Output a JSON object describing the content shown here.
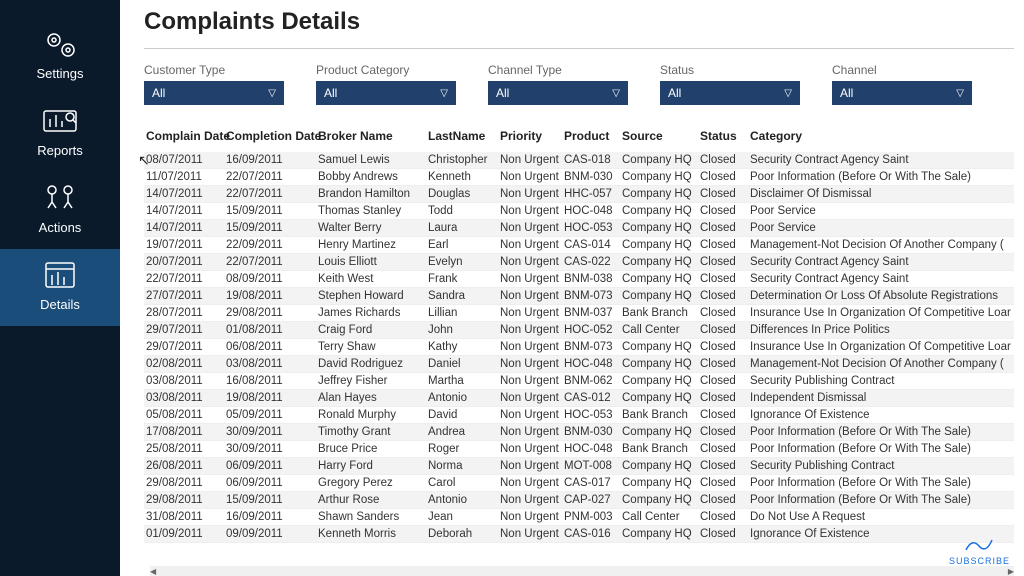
{
  "sidebar": {
    "items": [
      {
        "label": "Settings"
      },
      {
        "label": "Reports"
      },
      {
        "label": "Actions"
      },
      {
        "label": "Details"
      }
    ]
  },
  "page": {
    "title": "Complaints Details"
  },
  "filters": [
    {
      "label": "Customer Type",
      "value": "All"
    },
    {
      "label": "Product Category",
      "value": "All"
    },
    {
      "label": "Channel Type",
      "value": "All"
    },
    {
      "label": "Status",
      "value": "All"
    },
    {
      "label": "Channel",
      "value": "All"
    }
  ],
  "table": {
    "headers": [
      "Complain Date",
      "Completion Date",
      "Broker Name",
      "LastName",
      "Priority",
      "Product",
      "Source",
      "Status",
      "Category"
    ],
    "rows": [
      [
        "08/07/2011",
        "16/09/2011",
        "Samuel Lewis",
        "Christopher",
        "Non Urgent",
        "CAS-018",
        "Company HQ",
        "Closed",
        "Security Contract Agency Saint"
      ],
      [
        "11/07/2011",
        "22/07/2011",
        "Bobby Andrews",
        "Kenneth",
        "Non Urgent",
        "BNM-030",
        "Company HQ",
        "Closed",
        "Poor Information (Before Or With The Sale)"
      ],
      [
        "14/07/2011",
        "22/07/2011",
        "Brandon Hamilton",
        "Douglas",
        "Non Urgent",
        "HHC-057",
        "Company HQ",
        "Closed",
        "Disclaimer Of Dismissal"
      ],
      [
        "14/07/2011",
        "15/09/2011",
        "Thomas Stanley",
        "Todd",
        "Non Urgent",
        "HOC-048",
        "Company HQ",
        "Closed",
        "Poor Service"
      ],
      [
        "14/07/2011",
        "15/09/2011",
        "Walter Berry",
        "Laura",
        "Non Urgent",
        "HOC-053",
        "Company HQ",
        "Closed",
        "Poor Service"
      ],
      [
        "19/07/2011",
        "22/09/2011",
        "Henry Martinez",
        "Earl",
        "Non Urgent",
        "CAS-014",
        "Company HQ",
        "Closed",
        "Management-Not Decision Of Another Company ("
      ],
      [
        "20/07/2011",
        "22/07/2011",
        "Louis Elliott",
        "Evelyn",
        "Non Urgent",
        "CAS-022",
        "Company HQ",
        "Closed",
        "Security Contract Agency Saint"
      ],
      [
        "22/07/2011",
        "08/09/2011",
        "Keith West",
        "Frank",
        "Non Urgent",
        "BNM-038",
        "Company HQ",
        "Closed",
        "Security Contract Agency Saint"
      ],
      [
        "27/07/2011",
        "19/08/2011",
        "Stephen Howard",
        "Sandra",
        "Non Urgent",
        "BNM-073",
        "Company HQ",
        "Closed",
        "Determination Or Loss Of Absolute Registrations"
      ],
      [
        "28/07/2011",
        "29/08/2011",
        "James Richards",
        "Lillian",
        "Non Urgent",
        "BNM-037",
        "Bank Branch",
        "Closed",
        "Insurance Use In Organization Of Competitive Loar"
      ],
      [
        "29/07/2011",
        "01/08/2011",
        "Craig Ford",
        "John",
        "Non Urgent",
        "HOC-052",
        "Call Center",
        "Closed",
        "Differences In Price Politics"
      ],
      [
        "29/07/2011",
        "06/08/2011",
        "Terry Shaw",
        "Kathy",
        "Non Urgent",
        "BNM-073",
        "Company HQ",
        "Closed",
        "Insurance Use In Organization Of Competitive Loar"
      ],
      [
        "02/08/2011",
        "03/08/2011",
        "David Rodriguez",
        "Daniel",
        "Non Urgent",
        "HOC-048",
        "Company HQ",
        "Closed",
        "Management-Not Decision Of Another Company ("
      ],
      [
        "03/08/2011",
        "16/08/2011",
        "Jeffrey Fisher",
        "Martha",
        "Non Urgent",
        "BNM-062",
        "Company HQ",
        "Closed",
        "Security Publishing Contract"
      ],
      [
        "03/08/2011",
        "19/08/2011",
        "Alan Hayes",
        "Antonio",
        "Non Urgent",
        "CAS-012",
        "Company HQ",
        "Closed",
        "Independent Dismissal"
      ],
      [
        "05/08/2011",
        "05/09/2011",
        "Ronald Murphy",
        "David",
        "Non Urgent",
        "HOC-053",
        "Bank Branch",
        "Closed",
        "Ignorance Of Existence"
      ],
      [
        "17/08/2011",
        "30/09/2011",
        "Timothy Grant",
        "Andrea",
        "Non Urgent",
        "BNM-030",
        "Company HQ",
        "Closed",
        "Poor Information (Before Or With The Sale)"
      ],
      [
        "25/08/2011",
        "30/09/2011",
        "Bruce Price",
        "Roger",
        "Non Urgent",
        "HOC-048",
        "Bank Branch",
        "Closed",
        "Poor Information (Before Or With The Sale)"
      ],
      [
        "26/08/2011",
        "06/09/2011",
        "Harry Ford",
        "Norma",
        "Non Urgent",
        "MOT-008",
        "Company HQ",
        "Closed",
        "Security Publishing Contract"
      ],
      [
        "29/08/2011",
        "06/09/2011",
        "Gregory Perez",
        "Carol",
        "Non Urgent",
        "CAS-017",
        "Company HQ",
        "Closed",
        "Poor Information (Before Or With The Sale)"
      ],
      [
        "29/08/2011",
        "15/09/2011",
        "Arthur Rose",
        "Antonio",
        "Non Urgent",
        "CAP-027",
        "Company HQ",
        "Closed",
        "Poor Information (Before Or With The Sale)"
      ],
      [
        "31/08/2011",
        "16/09/2011",
        "Shawn Sanders",
        "Jean",
        "Non Urgent",
        "PNM-003",
        "Call Center",
        "Closed",
        "Do Not Use A Request"
      ],
      [
        "01/09/2011",
        "09/09/2011",
        "Kenneth Morris",
        "Deborah",
        "Non Urgent",
        "CAS-016",
        "Company HQ",
        "Closed",
        "Ignorance Of Existence"
      ]
    ]
  },
  "subscribe": {
    "label": "SUBSCRIBE"
  }
}
